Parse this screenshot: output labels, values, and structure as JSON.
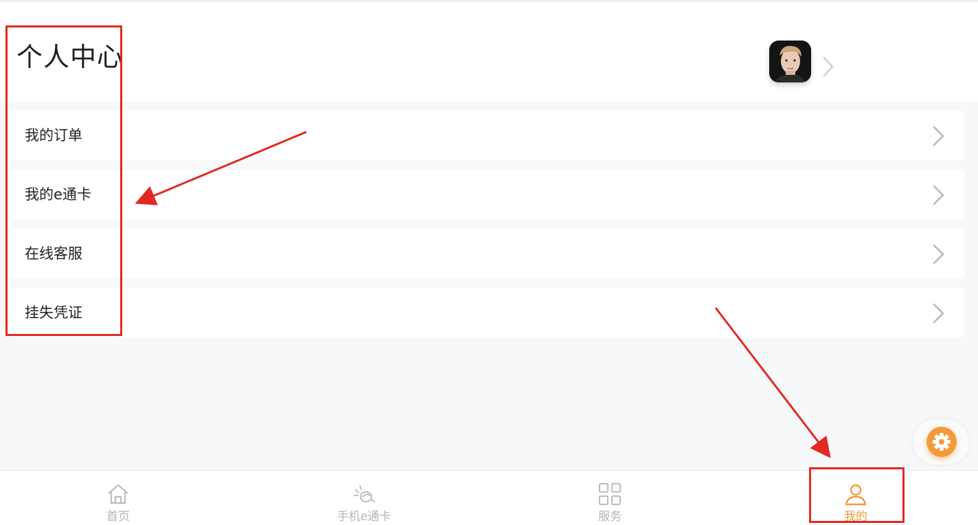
{
  "header": {
    "title": "个人中心",
    "avatar_icon": "user-avatar-photo",
    "chevron_icon": "chevron-right-icon"
  },
  "menu": {
    "items": [
      {
        "label": "我的订单",
        "icon": "chevron-right-icon"
      },
      {
        "label": "我的e通卡",
        "icon": "chevron-right-icon"
      },
      {
        "label": "在线客服",
        "icon": "chevron-right-icon"
      },
      {
        "label": "挂失凭证",
        "icon": "chevron-right-icon"
      }
    ]
  },
  "floating_button": {
    "icon": "gear-icon",
    "color": "#f39a3b"
  },
  "tabbar": {
    "tabs": [
      {
        "label": "首页",
        "icon": "home-icon",
        "active": false
      },
      {
        "label": "手机e通卡",
        "icon": "nfc-card-icon",
        "active": false
      },
      {
        "label": "服务",
        "icon": "grid-icon",
        "active": false
      },
      {
        "label": "我的",
        "icon": "user-icon",
        "active": true
      }
    ],
    "active_color": "#f39a3b",
    "inactive_color": "#b5b5b5"
  },
  "annotations": {
    "color": "#e22a22"
  }
}
